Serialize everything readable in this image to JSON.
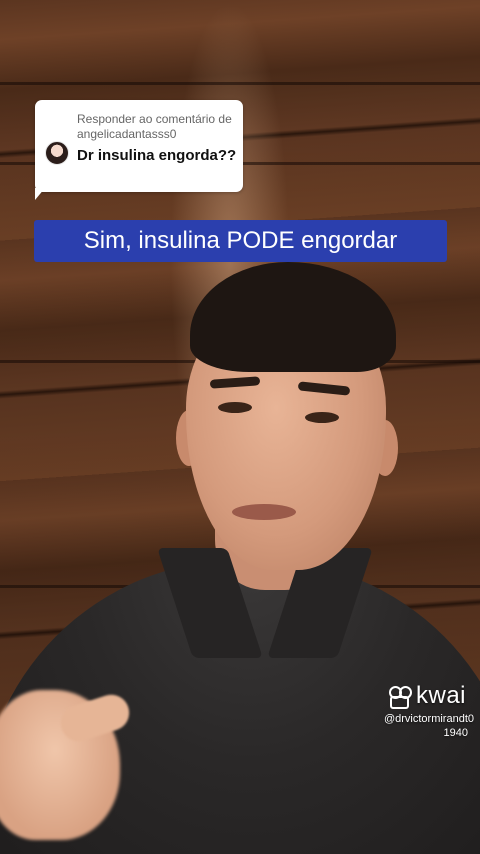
{
  "reply": {
    "prefix": "Responder ao comentário de",
    "username": "angelicadantasss0",
    "comment": "Dr insulina engorda??"
  },
  "caption": {
    "text": "Sim, insulina PODE engordar",
    "background_color": "#2b3fae"
  },
  "watermark": {
    "brand": "kwai",
    "handle": "@drvictormirandt0",
    "id": "1940"
  },
  "icons": {
    "brand_icon": "kwai-logo-icon",
    "avatar": "commenter-avatar"
  },
  "colors": {
    "card_background": "#ffffff",
    "caption_text": "#ffffff"
  }
}
